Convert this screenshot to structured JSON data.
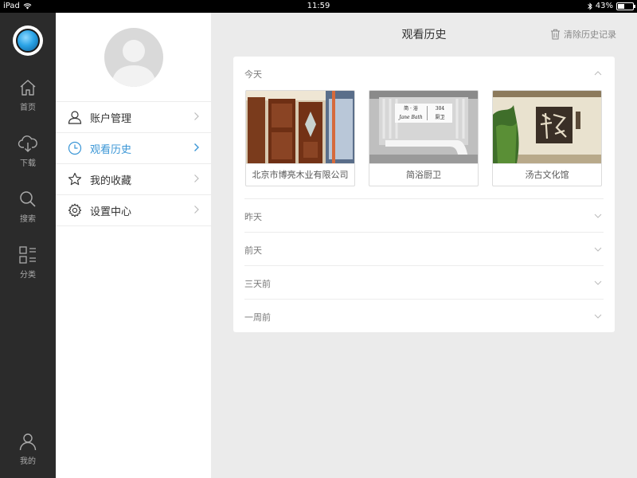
{
  "statusbar": {
    "device": "iPad",
    "time": "11:59",
    "battery": "43%",
    "battery_level": 0.43
  },
  "nav": {
    "items": [
      {
        "label": "首页",
        "icon": "home-icon"
      },
      {
        "label": "下载",
        "icon": "cloud-download-icon"
      },
      {
        "label": "搜索",
        "icon": "search-icon"
      },
      {
        "label": "分类",
        "icon": "category-icon"
      }
    ],
    "profile": {
      "label": "我的",
      "icon": "user-icon"
    }
  },
  "menu": {
    "items": [
      {
        "label": "账户管理",
        "icon": "user-outline-icon"
      },
      {
        "label": "观看历史",
        "icon": "clock-icon",
        "active": true
      },
      {
        "label": "我的收藏",
        "icon": "star-icon"
      },
      {
        "label": "设置中心",
        "icon": "gear-icon"
      }
    ]
  },
  "main": {
    "title": "观看历史",
    "clear_label": "清除历史记录",
    "sections": [
      {
        "label": "今天",
        "expanded": true
      },
      {
        "label": "昨天"
      },
      {
        "label": "前天"
      },
      {
        "label": "三天前"
      },
      {
        "label": "一周前"
      }
    ],
    "items": [
      {
        "label": "北京市博亮木业有限公司"
      },
      {
        "label": "简浴厨卫",
        "sign_line1": "简 · 浴",
        "sign_line2": "Jane Bath",
        "sign_line3": "304",
        "sign_line4": "厨卫"
      },
      {
        "label": "汤古文化馆"
      }
    ]
  },
  "colors": {
    "accent": "#3a96d6",
    "nav_bg": "#2b2b2b",
    "page_bg": "#ebebeb"
  }
}
